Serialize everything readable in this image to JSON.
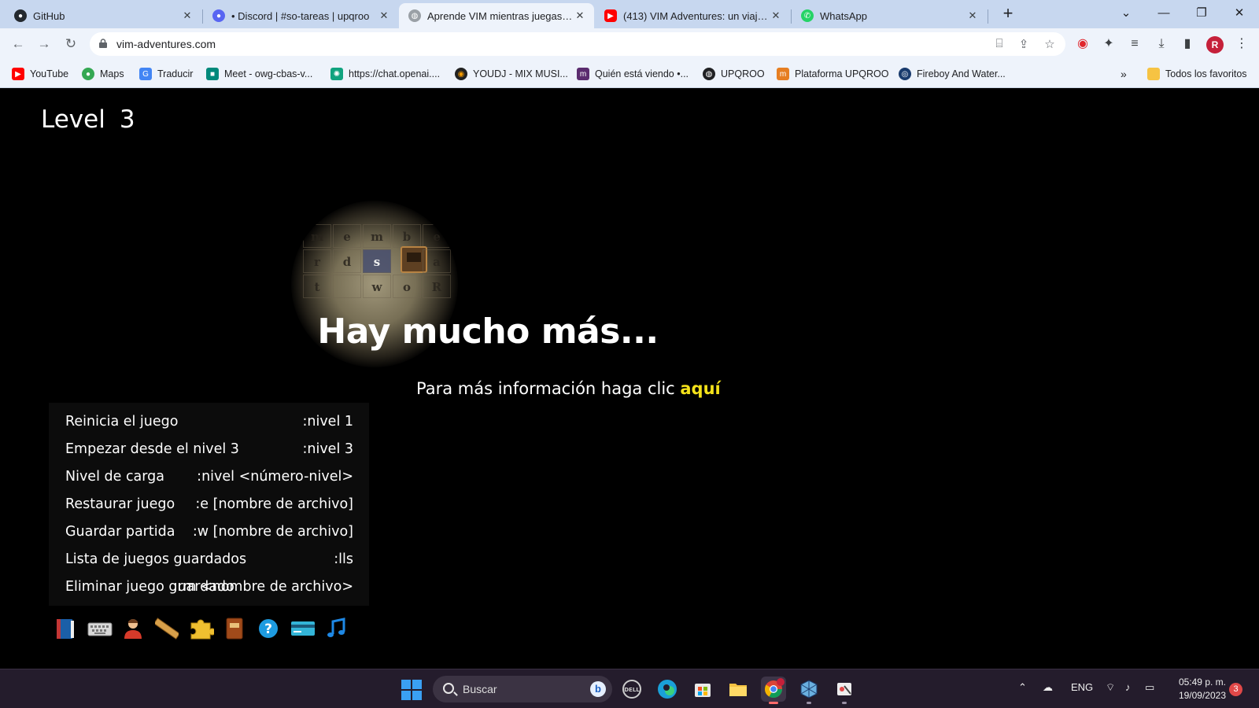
{
  "browser": {
    "tabs": [
      {
        "title": "GitHub",
        "icon": "github-icon",
        "active": false
      },
      {
        "title": "• Discord | #so-tareas | upqroo",
        "icon": "discord-icon",
        "active": false
      },
      {
        "title": "Aprende VIM mientras juegas - V",
        "icon": "globe-icon",
        "active": true
      },
      {
        "title": "(413) VIM Adventures: un viaje d",
        "icon": "youtube-icon",
        "active": false
      },
      {
        "title": "WhatsApp",
        "icon": "whatsapp-icon",
        "active": false
      }
    ],
    "new_tab": "+",
    "url": "vim-adventures.com",
    "profile_initial": "R",
    "bookmarks": [
      {
        "label": "YouTube",
        "color": "#ff0000"
      },
      {
        "label": "Maps",
        "color": "#34a853"
      },
      {
        "label": "Traducir",
        "color": "#4285f4"
      },
      {
        "label": "Meet - owg-cbas-v...",
        "color": "#00897b"
      },
      {
        "label": "https://chat.openai....",
        "color": "#10a37f"
      },
      {
        "label": "YOUDJ - MIX MUSI...",
        "color": "#f29900"
      },
      {
        "label": "Quién está viendo •...",
        "color": "#5b2c6f"
      },
      {
        "label": "UPQROO",
        "color": "#202124"
      },
      {
        "label": "Plataforma UPQROO",
        "color": "#e67e22"
      },
      {
        "label": "Fireboy And Water...",
        "color": "#1a3c6e"
      }
    ],
    "bookmarks_more": "»",
    "all_bookmarks": "Todos los favoritos"
  },
  "game": {
    "level_label": "Level",
    "level_number": "3",
    "grid_letters": [
      [
        "m",
        "e",
        "m",
        "b",
        "e"
      ],
      [
        "r",
        "d",
        "s",
        "",
        "a"
      ],
      [
        "t",
        "",
        "w",
        "o",
        "R"
      ]
    ],
    "headline": "Hay mucho más...",
    "info_text": "Para más información haga clic ",
    "info_link": "aquí",
    "menu": [
      {
        "label": "Reinicia el juego",
        "command": ":nivel 1"
      },
      {
        "label": "Empezar desde el nivel 3",
        "command": ":nivel 3"
      },
      {
        "label": "Nivel de carga",
        "command": ":nivel <número-nivel>"
      },
      {
        "label": "Restaurar juego",
        "command": ":e [nombre de archivo]"
      },
      {
        "label": "Guardar partida",
        "command": ":w [nombre de archivo]"
      },
      {
        "label": "Lista de juegos guardados",
        "command": ":lls"
      },
      {
        "label": "Eliminar juego guardado",
        "command": ":rm <nombre de archivo>"
      }
    ],
    "toolbar_icons": [
      "book-icon",
      "keyboard-icon",
      "user-icon",
      "ruler-icon",
      "puzzle-icon",
      "manual-icon",
      "help-icon",
      "credit-card-icon",
      "music-icon"
    ],
    "link_color": "#f4e21a"
  },
  "taskbar": {
    "search_placeholder": "Buscar",
    "language": "ENG",
    "time": "05:49 p. m.",
    "date": "19/09/2023",
    "notifications": "3"
  }
}
